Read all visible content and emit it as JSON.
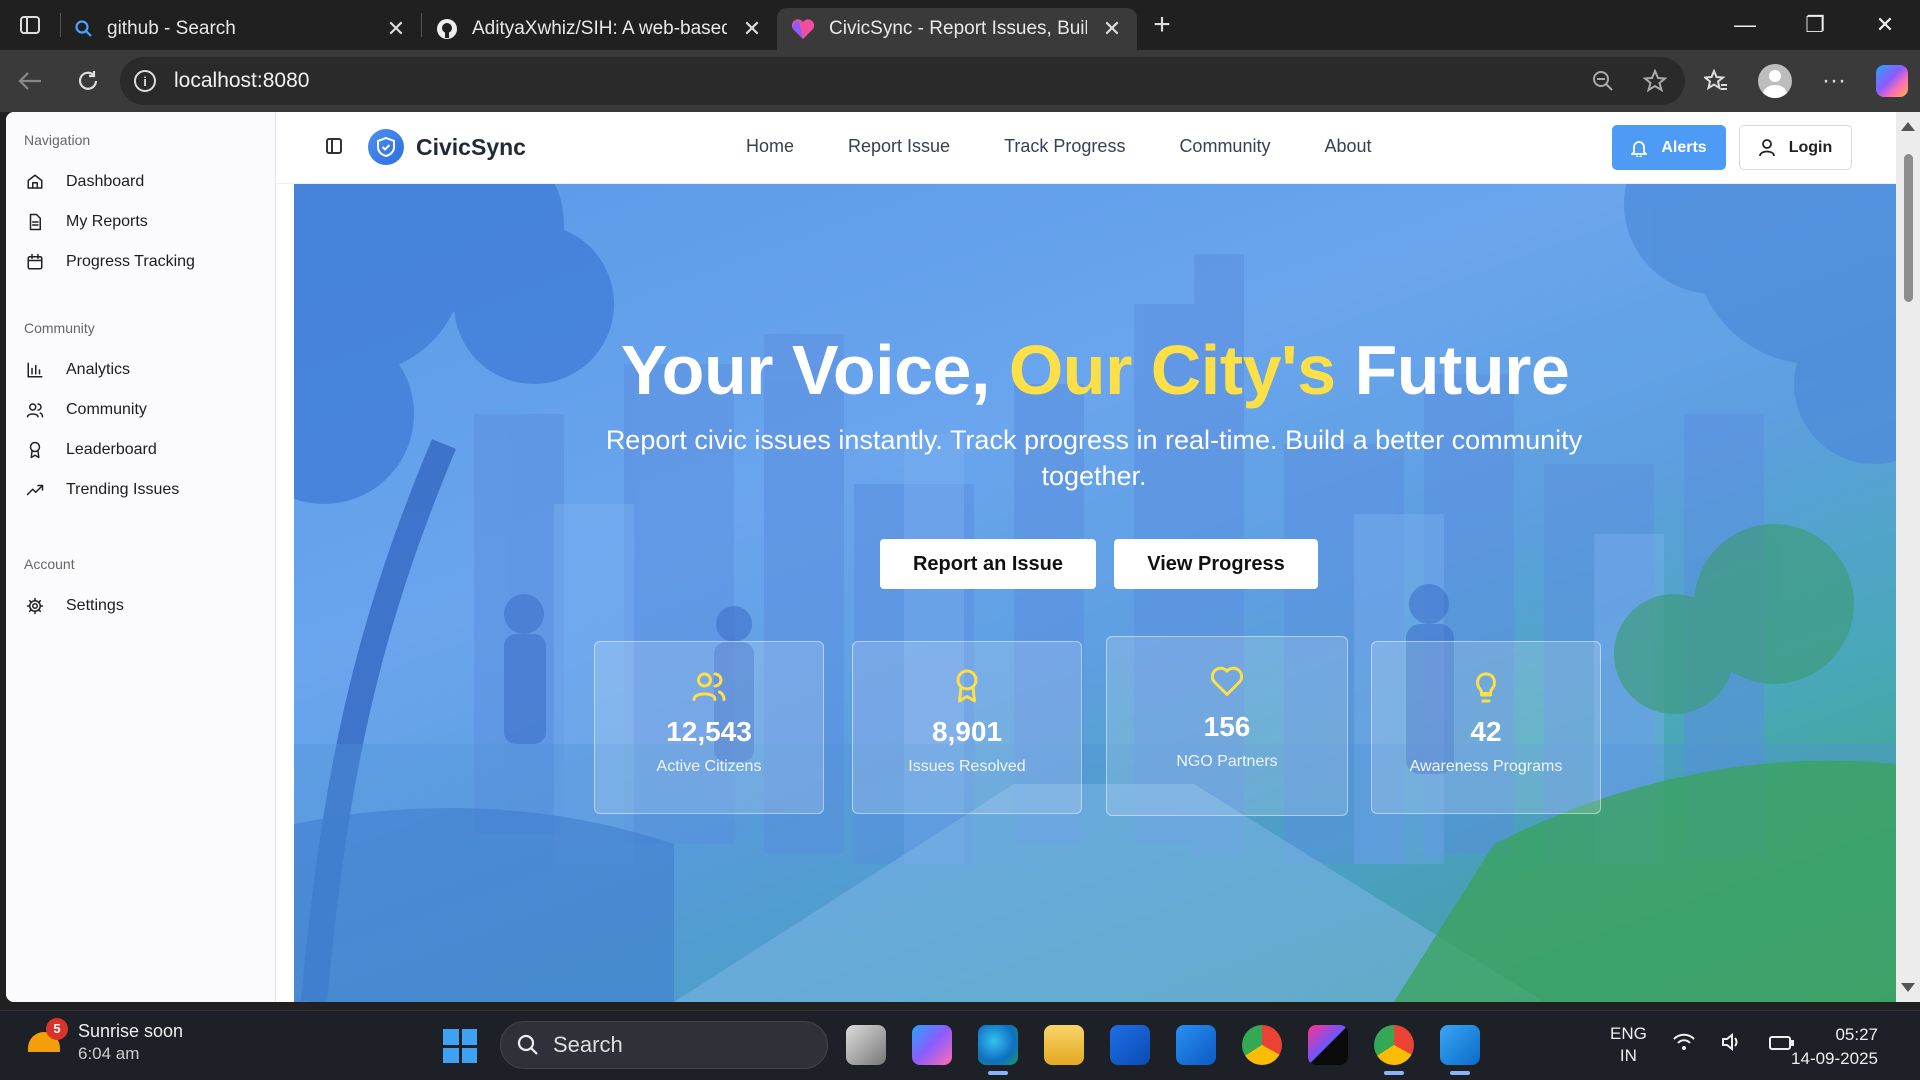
{
  "browser": {
    "tabs": [
      {
        "title": "github - Search"
      },
      {
        "title": "AdityaXwhiz/SIH: A web-based civic"
      },
      {
        "title": "CivicSync - Report Issues, Build Better"
      }
    ],
    "address": "localhost:8080"
  },
  "sidebar": {
    "groups": [
      {
        "heading": "Navigation",
        "items": [
          {
            "label": "Dashboard",
            "icon": "home-icon"
          },
          {
            "label": "My Reports",
            "icon": "file-icon"
          },
          {
            "label": "Progress Tracking",
            "icon": "calendar-icon"
          }
        ]
      },
      {
        "heading": "Community",
        "items": [
          {
            "label": "Analytics",
            "icon": "bar-chart-icon"
          },
          {
            "label": "Community",
            "icon": "users-icon"
          },
          {
            "label": "Leaderboard",
            "icon": "award-icon"
          },
          {
            "label": "Trending Issues",
            "icon": "trending-icon"
          }
        ]
      },
      {
        "heading": "Account",
        "items": [
          {
            "label": "Settings",
            "icon": "gear-icon"
          }
        ]
      }
    ]
  },
  "header": {
    "brand": "CivicSync",
    "nav": [
      "Home",
      "Report Issue",
      "Track Progress",
      "Community",
      "About"
    ],
    "alerts_label": "Alerts",
    "login_label": "Login"
  },
  "hero": {
    "title_part1": "Your Voice,",
    "title_accent": "Our City's",
    "title_part2": "Future",
    "subtitle": "Report civic issues instantly. Track progress in real-time. Build a better community together.",
    "primary_button": "Report an Issue",
    "secondary_button": "View Progress",
    "accent_color": "#fde047",
    "stats": [
      {
        "value": "12,543",
        "label": "Active Citizens",
        "icon": "users-icon"
      },
      {
        "value": "8,901",
        "label": "Issues Resolved",
        "icon": "award-icon"
      },
      {
        "value": "156",
        "label": "NGO Partners",
        "icon": "heart-icon"
      },
      {
        "value": "42",
        "label": "Awareness Programs",
        "icon": "lightbulb-icon"
      }
    ]
  },
  "taskbar": {
    "weather_title": "Sunrise soon",
    "weather_time": "6:04 am",
    "weather_badge": "5",
    "search_placeholder": "Search",
    "lang_line1": "ENG",
    "lang_line2": "IN",
    "time": "05:27",
    "date": "14-09-2025"
  }
}
